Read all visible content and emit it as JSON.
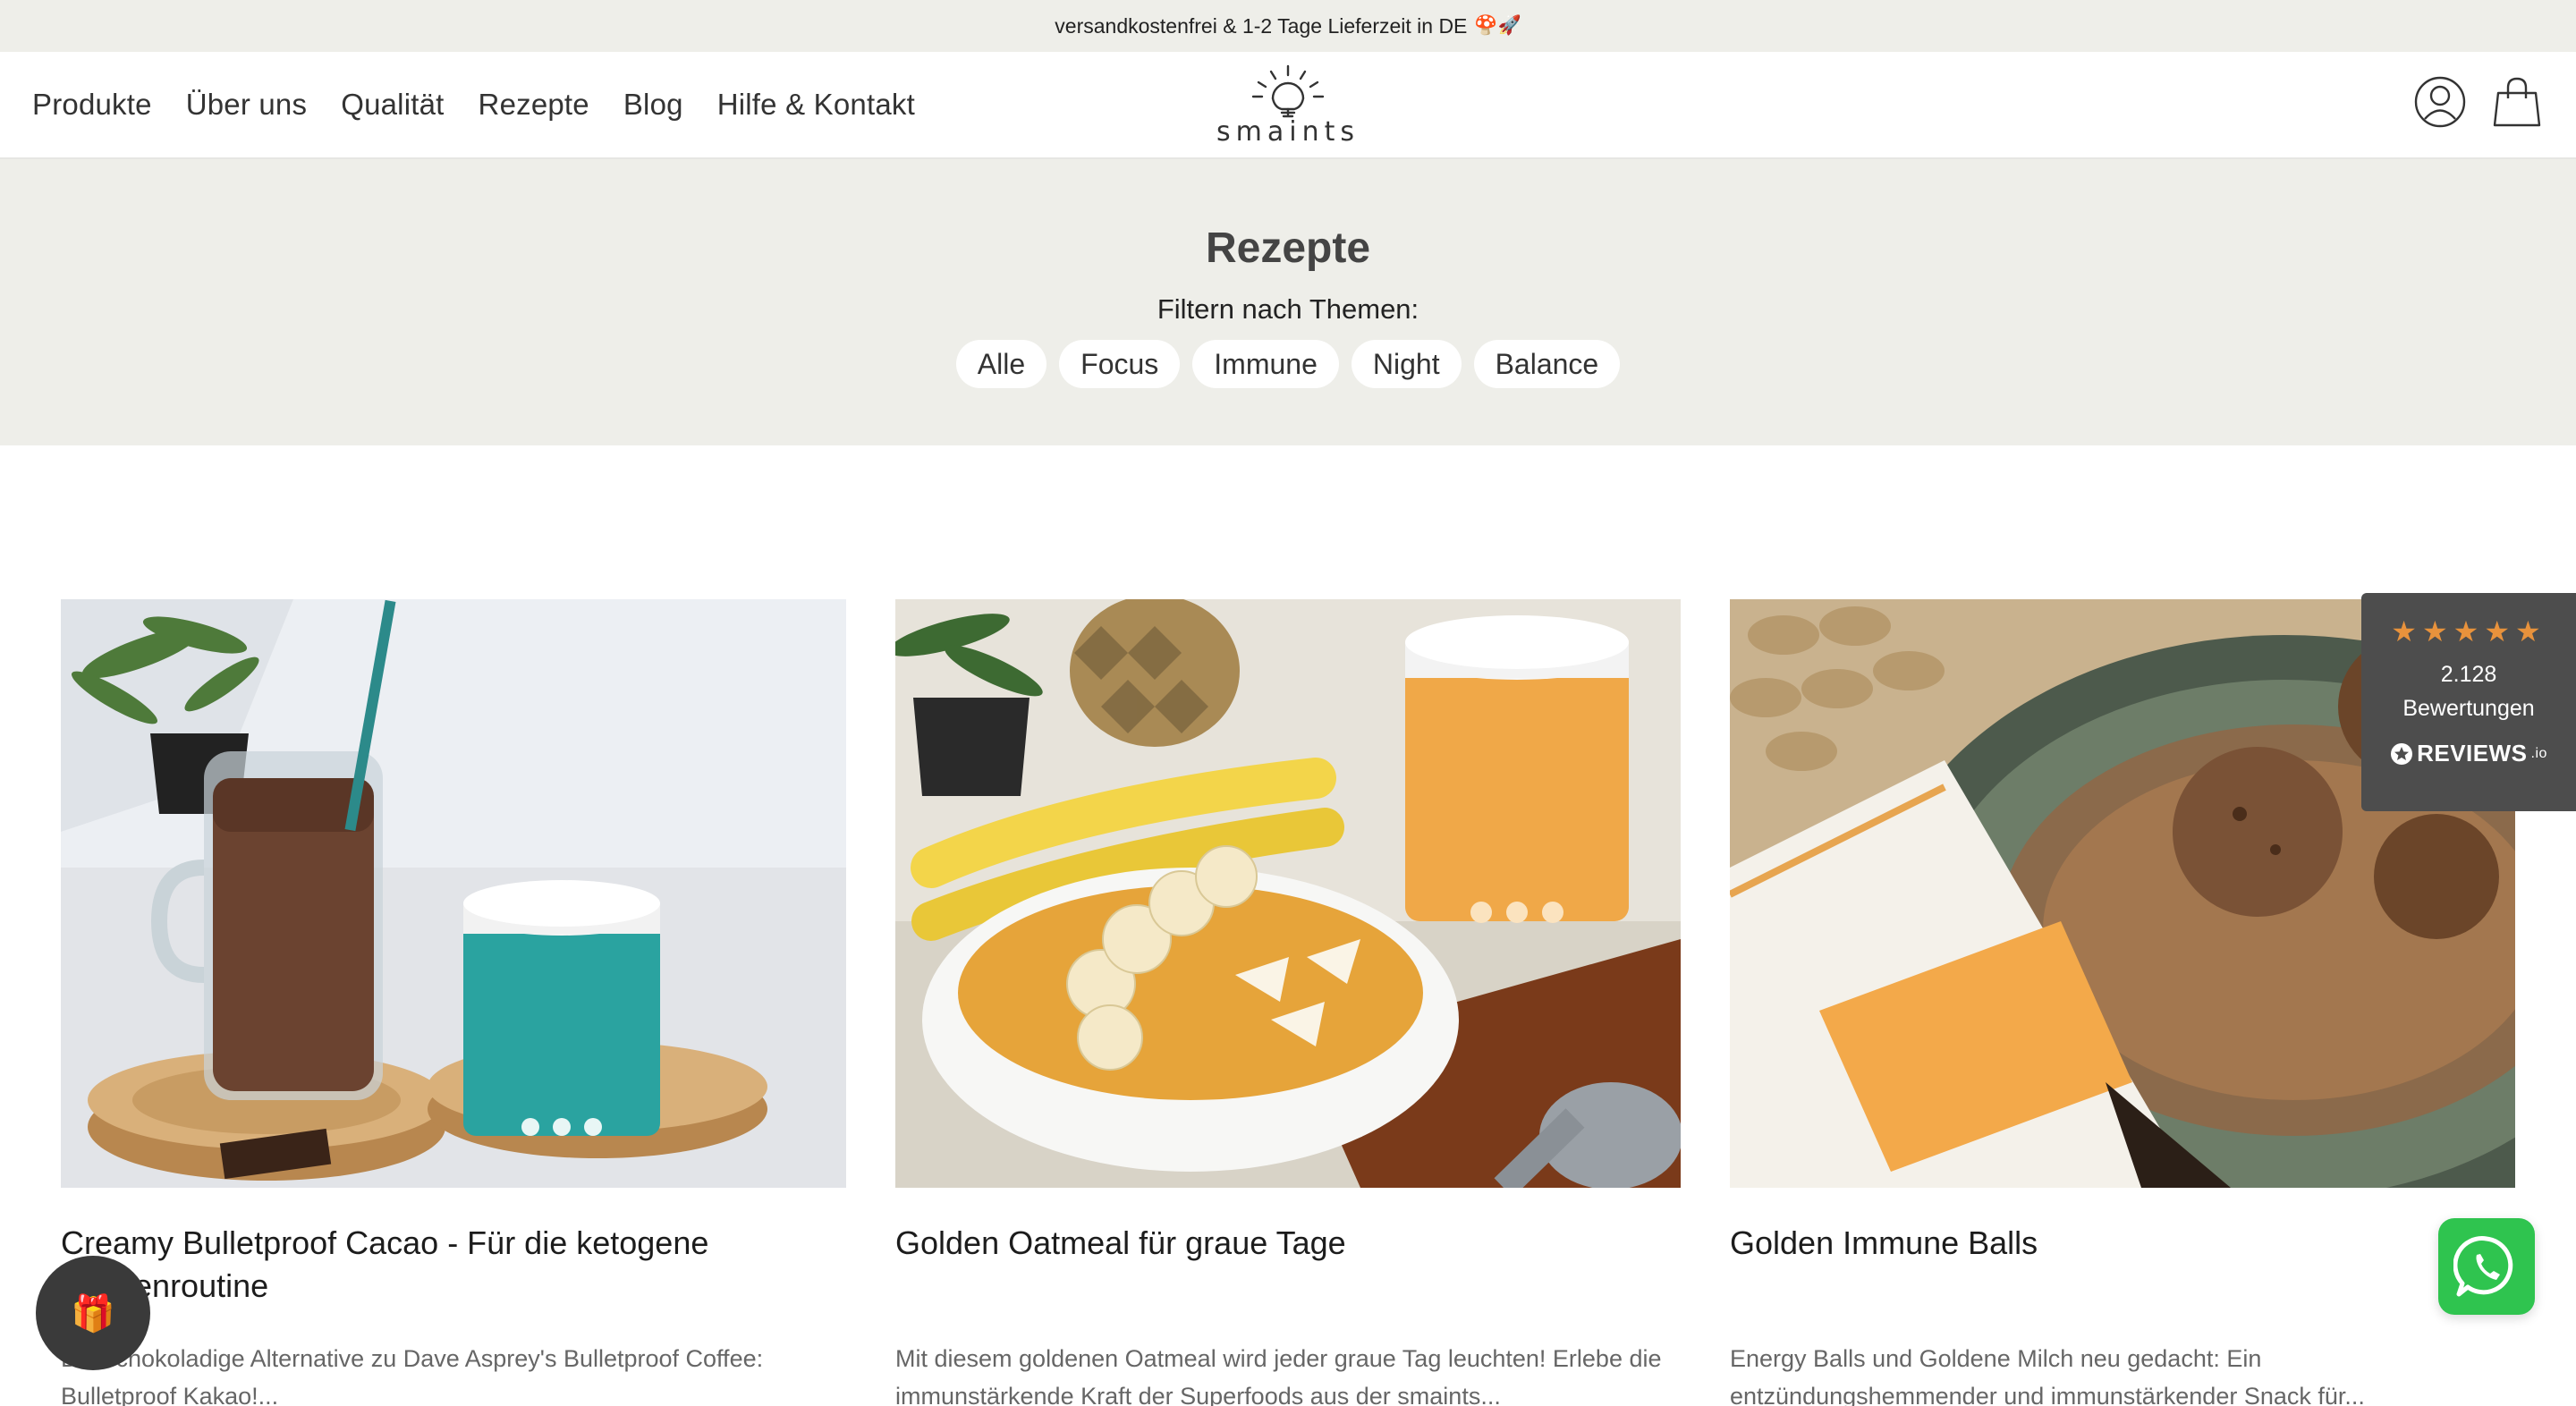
{
  "announcement": {
    "text": "versandkostenfrei & 1-2 Tage Lieferzeit in DE",
    "emoji": "🍄🚀"
  },
  "nav": {
    "items": [
      "Produkte",
      "Über uns",
      "Qualität",
      "Rezepte",
      "Blog",
      "Hilfe & Kontakt"
    ]
  },
  "logo": {
    "wordmark": "smaints"
  },
  "header_icons": [
    "user-icon",
    "shopping-bag-icon"
  ],
  "hero": {
    "title": "Rezepte",
    "filter_label": "Filtern nach Themen:",
    "filters": [
      "Alle",
      "Focus",
      "Immune",
      "Night",
      "Balance"
    ]
  },
  "cards": [
    {
      "title": "Creamy Bulletproof Cacao - Für die ketogene Morgenroutine",
      "excerpt": "Die schokoladige Alternative zu Dave Asprey's Bulletproof Coffee: Bulletproof Kakao!..."
    },
    {
      "title": "Golden Oatmeal für graue Tage",
      "excerpt": "Mit diesem goldenen Oatmeal wird jeder graue Tag leuchten! Erlebe die immunstärkende Kraft der Superfoods aus der smaints..."
    },
    {
      "title": "Golden Immune Balls",
      "excerpt": "Energy Balls und Goldene Milch neu gedacht: Ein entzündungshemmender und immunstärkender Snack für..."
    }
  ],
  "reviews": {
    "stars": "★★★★★",
    "rating_fraction": 0.9,
    "count": "2.128",
    "label": "Bewertungen",
    "brand": "REVIEWS",
    "brand_suffix": ".io"
  },
  "colors": {
    "announcement_bg": "#eeeee9",
    "hero_bg": "#eeeee9",
    "star_color": "#e8923c",
    "whatsapp_green": "#2fc44f",
    "reviews_bg": "#4d4d4d"
  },
  "floating": {
    "whatsapp_icon": "whatsapp-icon",
    "gift_icon": "gift-icon",
    "gift_emoji": "🎁"
  }
}
